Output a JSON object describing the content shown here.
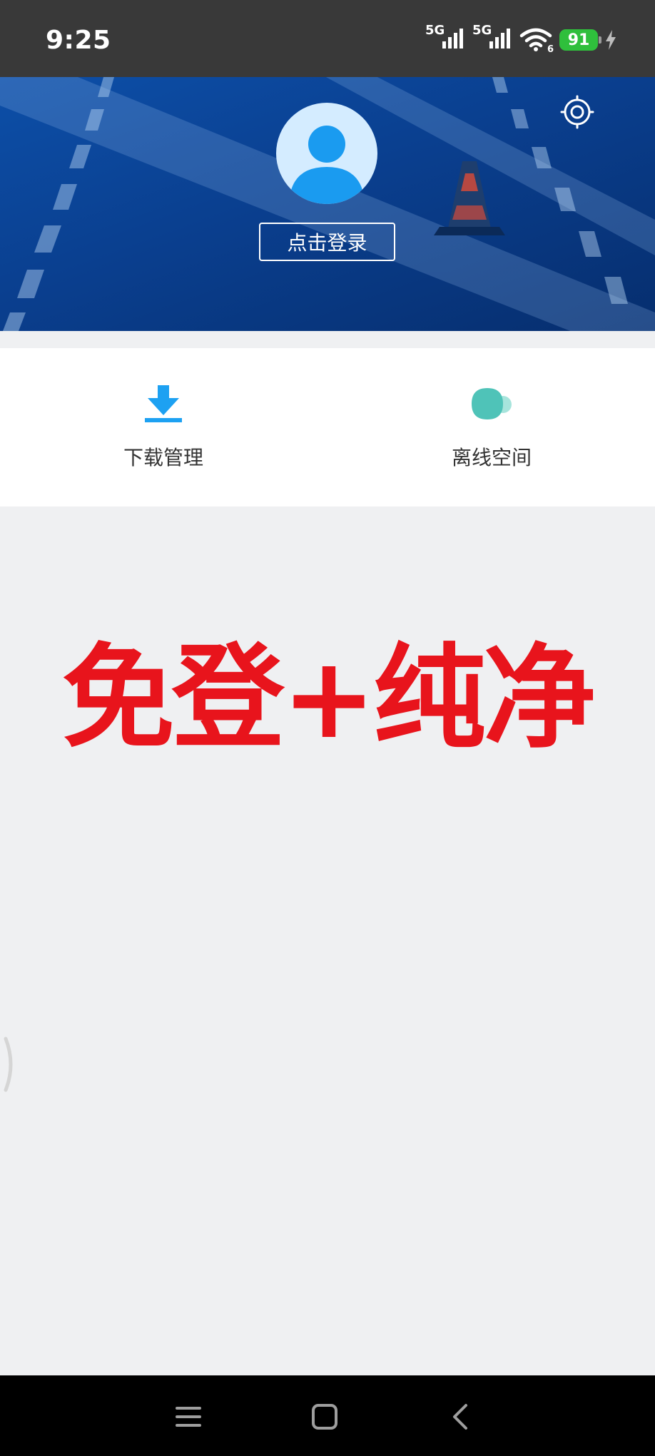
{
  "status_bar": {
    "time": "9:25",
    "signal1_label": "5G",
    "signal2_label": "5G",
    "wifi_sub": "6",
    "battery": "91"
  },
  "header": {
    "login_button": "点击登录",
    "settings_icon": "settings-gear-icon",
    "avatar_icon": "user-avatar-icon",
    "background_color": "#0a3f8f"
  },
  "actions": [
    {
      "label": "下载管理",
      "icon": "download-icon",
      "color": "#1da1f2"
    },
    {
      "label": "离线空间",
      "icon": "cloud-icon",
      "color": "#4fc3b8"
    }
  ],
  "overlay": {
    "text": "免登+纯净",
    "color": "#e8141c"
  },
  "nav_bar": {
    "icons": [
      "menu-icon",
      "home-icon",
      "back-icon"
    ]
  }
}
